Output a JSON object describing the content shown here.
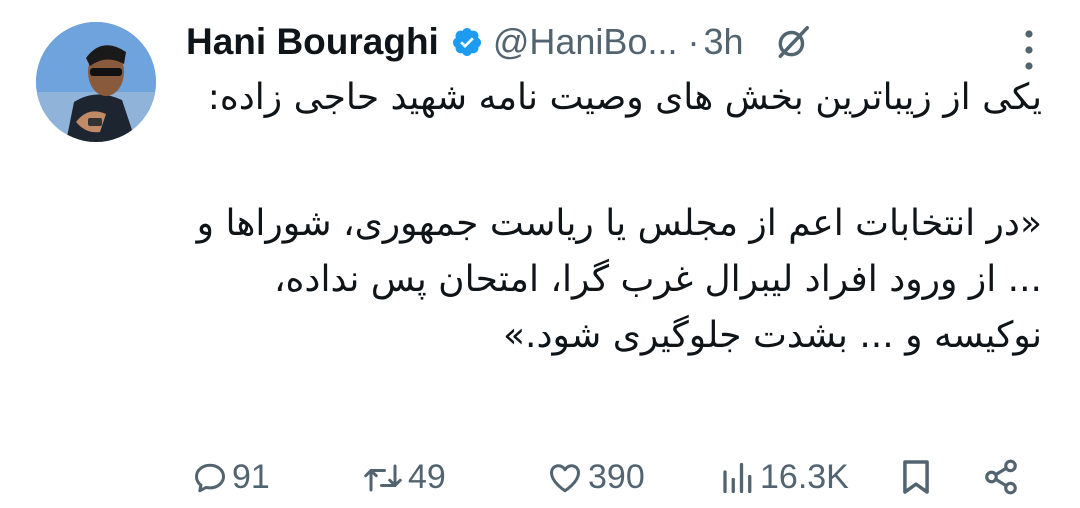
{
  "author": {
    "name": "Hani Bouraghi",
    "handle": "@HaniBo...",
    "separator": "·",
    "time": "3h"
  },
  "tweet": {
    "lines": [
      "یکی از زیباترین بخش های وصیت نامه شهید حاجی زاده:",
      "«در انتخابات اعم از مجلس یا ریاست جمهوری، شوراها و ... از ورود افراد لیبرال غرب گرا، امتحان پس نداده، نوکیسه و ... بشدت جلوگیری شود.»"
    ]
  },
  "actions": {
    "replies": "91",
    "reposts": "49",
    "likes": "390",
    "views": "16.3K"
  },
  "icons": [
    "verified-badge-icon",
    "grok-icon",
    "more-icon",
    "reply-icon",
    "repost-icon",
    "like-icon",
    "views-icon",
    "bookmark-icon",
    "share-icon"
  ],
  "colors": {
    "verified": "#1d9bf0",
    "secondary": "#536471",
    "text": "#0f1419"
  }
}
